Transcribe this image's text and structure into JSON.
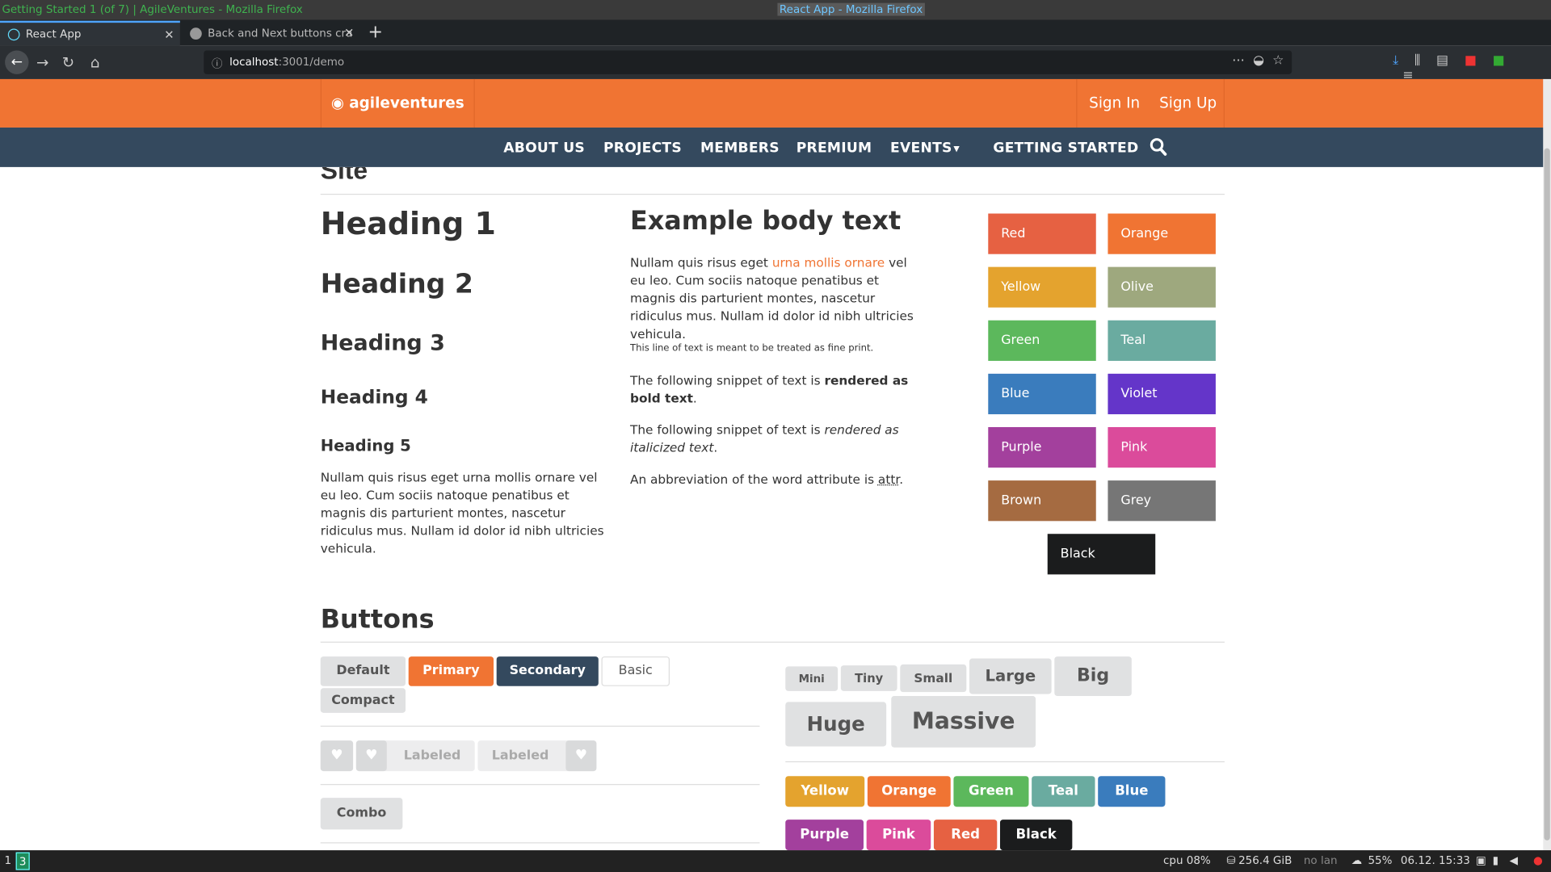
{
  "window": {
    "title_left": "Getting Started 1 (of 7) | AgileVentures - Mozilla Firefox",
    "title_center": "React App - Mozilla Firefox"
  },
  "tabs": [
    {
      "label": "React App"
    },
    {
      "label": "Back and Next buttons cra"
    }
  ],
  "url": {
    "host": "localhost",
    "rest": ":3001/demo"
  },
  "site": {
    "logo": "agileventures",
    "sign_in": "Sign In",
    "sign_up": "Sign Up",
    "menu": [
      "ABOUT US",
      "PROJECTS",
      "MEMBERS",
      "PREMIUM",
      "EVENTS",
      "GETTING STARTED"
    ],
    "dropdown_glyph": "▾"
  },
  "typography": {
    "site_heading": "Site",
    "h1": "Heading 1",
    "h2": "Heading 2",
    "h3": "Heading 3",
    "h4": "Heading 4",
    "h5": "Heading 5",
    "left_para": "Nullam quis risus eget urna mollis ornare vel eu leo. Cum sociis natoque penatibus et magnis dis parturient montes, nascetur ridiculus mus. Nullam id dolor id nibh ultricies vehicula.",
    "body_title": "Example body text",
    "p1_start": "Nullam quis risus eget ",
    "p1_link": "urna mollis ornare",
    "p1_end": " vel eu leo. Cum sociis natoque penatibus et magnis dis parturient montes, nascetur ridiculus mus. Nullam id dolor id nibh ultricies vehicula.",
    "fine_print": "This line of text is meant to be treated as fine print.",
    "bold_start": "The following snippet of text is ",
    "bold_text": "rendered as bold text",
    "italic_start": "The following snippet of text is ",
    "italic_text": "rendered as italicized text",
    "abbr_start": "An abbreviation of the word attribute is ",
    "abbr": "attr",
    "period": "."
  },
  "swatches": [
    {
      "label": "Red",
      "color": "#e66142"
    },
    {
      "label": "Orange",
      "color": "#f07433"
    },
    {
      "label": "Yellow",
      "color": "#e4a32e"
    },
    {
      "label": "Olive",
      "color": "#9ea87e"
    },
    {
      "label": "Green",
      "color": "#5cb85c"
    },
    {
      "label": "Teal",
      "color": "#6aaba0"
    },
    {
      "label": "Blue",
      "color": "#3a7cbd"
    },
    {
      "label": "Violet",
      "color": "#6435c9"
    },
    {
      "label": "Purple",
      "color": "#a3409d"
    },
    {
      "label": "Pink",
      "color": "#db4b9b"
    },
    {
      "label": "Brown",
      "color": "#a56b41"
    },
    {
      "label": "Grey",
      "color": "#767676"
    },
    {
      "label": "Black",
      "color": "#1b1c1d"
    }
  ],
  "buttons": {
    "heading": "Buttons",
    "default": "Default",
    "primary": "Primary",
    "secondary": "Secondary",
    "basic": "Basic",
    "compact": "Compact",
    "labeled": "Labeled",
    "combo": "Combo",
    "sizes": [
      "Mini",
      "Tiny",
      "Small",
      "Large",
      "Big",
      "Huge",
      "Massive"
    ],
    "colored": [
      {
        "label": "Yellow",
        "color": "#e4a32e"
      },
      {
        "label": "Orange",
        "color": "#f07433"
      },
      {
        "label": "Green",
        "color": "#5cb85c"
      },
      {
        "label": "Teal",
        "color": "#6aaba0"
      },
      {
        "label": "Blue",
        "color": "#3a7cbd"
      },
      {
        "label": "Purple",
        "color": "#a3409d"
      },
      {
        "label": "Pink",
        "color": "#db4b9b"
      },
      {
        "label": "Red",
        "color": "#e66142"
      },
      {
        "label": "Black",
        "color": "#1b1c1d"
      }
    ]
  },
  "taskbar": {
    "ws1": "1",
    "ws3": "3",
    "cpu": "cpu  08%",
    "disk": "256.4 GiB",
    "lan": "no lan",
    "battery": "55%",
    "datetime": "06.12. 15:33"
  }
}
